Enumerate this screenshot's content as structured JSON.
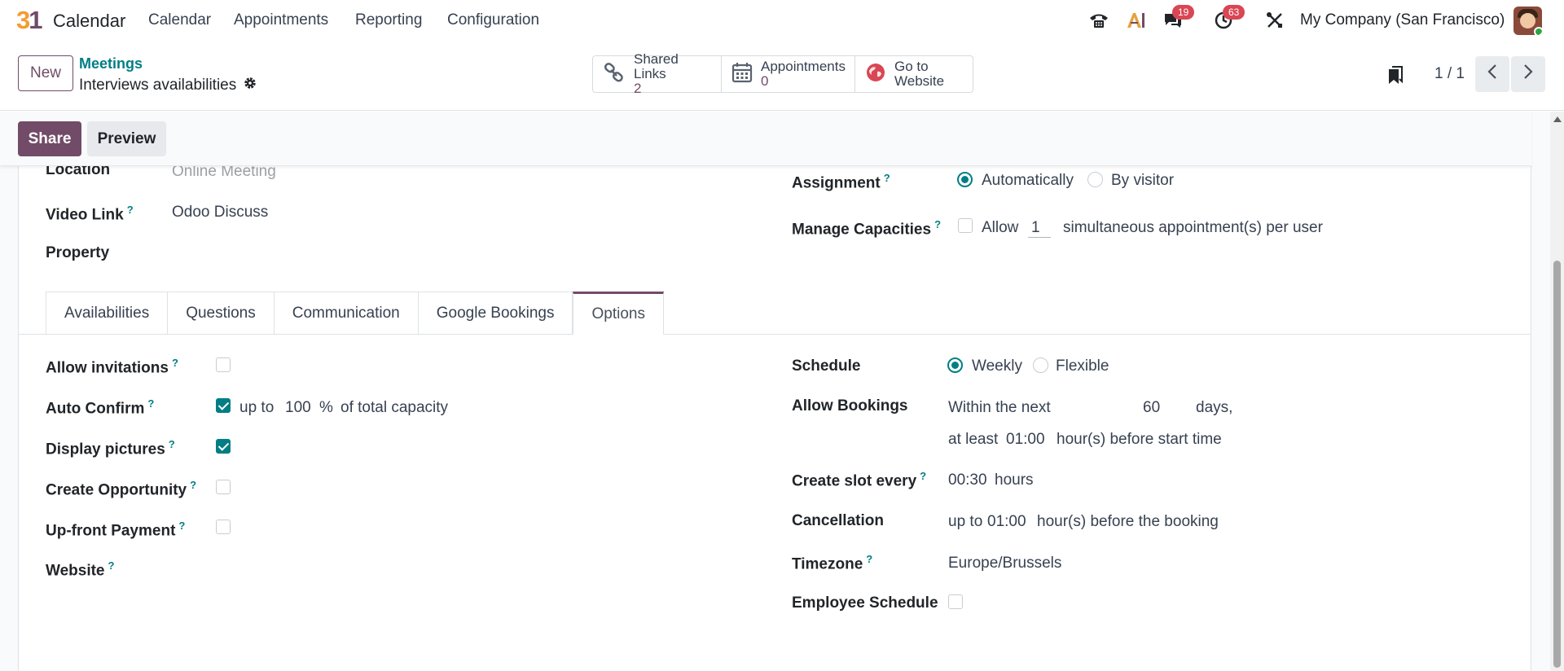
{
  "navbar": {
    "logo_3": "3",
    "logo_1": "1",
    "app_name": "Calendar",
    "menu": [
      "Calendar",
      "Appointments",
      "Reporting",
      "Configuration"
    ],
    "messages_badge": "19",
    "activities_badge": "63",
    "ai_label": "AI",
    "company": "My Company (San Francisco)"
  },
  "control": {
    "new_label": "New",
    "breadcrumb_parent": "Meetings",
    "breadcrumb_current": "Interviews availabilities",
    "stats": [
      {
        "label": "Shared Links",
        "value": "2"
      },
      {
        "label": "Appointments",
        "value": "0"
      },
      {
        "label": "Go to",
        "value": "Website"
      }
    ],
    "pager": "1 / 1"
  },
  "statusbar": {
    "share_label": "Share",
    "preview_label": "Preview"
  },
  "form": {
    "location_label": "Location",
    "location_value": "Online Meeting",
    "video_link_label": "Video Link",
    "video_link_value": "Odoo Discuss",
    "property_label": "Property",
    "assignment_label": "Assignment",
    "assignment_options": [
      "Automatically",
      "By visitor"
    ],
    "manage_capacities_label": "Manage Capacities",
    "capacities_allow": "Allow",
    "capacities_value": "1",
    "capacities_suffix": "simultaneous appointment(s) per user",
    "help_mark": "?"
  },
  "tabs": [
    "Availabilities",
    "Questions",
    "Communication",
    "Google Bookings",
    "Options"
  ],
  "options": {
    "allow_invitations_label": "Allow invitations",
    "auto_confirm_label": "Auto Confirm",
    "auto_confirm_upto": "up to",
    "auto_confirm_value": "100",
    "auto_confirm_percent": "%",
    "auto_confirm_suffix": "of total capacity",
    "display_pictures_label": "Display pictures",
    "create_opportunity_label": "Create Opportunity",
    "upfront_payment_label": "Up-front Payment",
    "website_label": "Website",
    "schedule_label": "Schedule",
    "schedule_options": [
      "Weekly",
      "Flexible"
    ],
    "allow_bookings_label": "Allow Bookings",
    "bookings_within": "Within the next",
    "bookings_days_value": "60",
    "bookings_days": "days,",
    "bookings_atleast": "at least",
    "bookings_hours_value": "01:00",
    "bookings_hours_suffix": "hour(s) before start time",
    "slot_label": "Create slot every",
    "slot_value": "00:30",
    "slot_unit": "hours",
    "cancellation_label": "Cancellation",
    "cancellation_upto": "up to",
    "cancellation_value": "01:00",
    "cancellation_suffix": "hour(s) before the booking",
    "timezone_label": "Timezone",
    "timezone_value": "Europe/Brussels",
    "employee_schedule_label": "Employee Schedule"
  },
  "colors": {
    "brand": "#714b67",
    "accent": "#017e84",
    "badge": "#d94654"
  }
}
